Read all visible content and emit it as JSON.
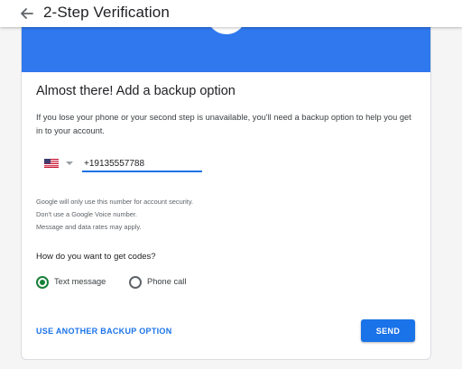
{
  "header": {
    "title": "2-Step Verification",
    "back_icon": "arrow-back-icon"
  },
  "banner": {
    "color": "#2f78ee",
    "icon": "check-icon"
  },
  "card": {
    "heading": "Almost there! Add a backup option",
    "description": "If you lose your phone or your second step is unavailable, you'll need a backup option to help you get in to your account."
  },
  "phone": {
    "country_flag": "us-flag-icon",
    "value": "+19135557788",
    "accent_color": "#1a73e8"
  },
  "disclaimer": {
    "line1": "Google will only use this number for account security.",
    "line2": "Don't use a Google Voice number.",
    "line3": "Message and data rates may apply."
  },
  "codes": {
    "question": "How do you want to get codes?",
    "options": [
      {
        "label": "Text message",
        "selected": true
      },
      {
        "label": "Phone call",
        "selected": false
      }
    ],
    "selected_color": "#188038"
  },
  "actions": {
    "other_option": "USE ANOTHER BACKUP OPTION",
    "send": "SEND"
  }
}
